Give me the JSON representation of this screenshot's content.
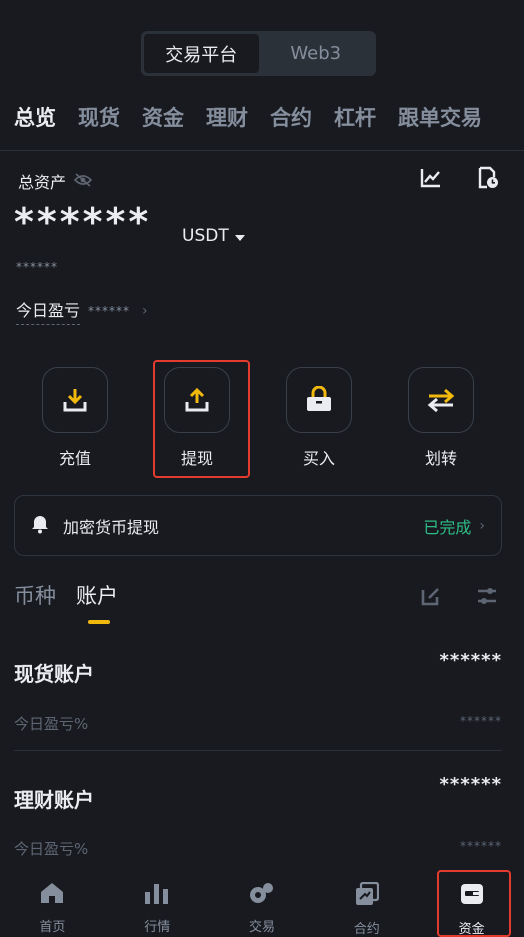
{
  "platform_switch": {
    "items": [
      "交易平台",
      "Web3"
    ],
    "active": 0
  },
  "main_tabs": [
    "总览",
    "现货",
    "资金",
    "理财",
    "合约",
    "杠杆",
    "跟单交易"
  ],
  "overview": {
    "total_label": "总资产",
    "total_value": "******",
    "currency": "USDT",
    "sub_value": "******",
    "today_pnl_label": "今日盈亏",
    "today_pnl_value": "******"
  },
  "actions": [
    {
      "label": "充值",
      "icon": "deposit-icon"
    },
    {
      "label": "提现",
      "icon": "withdraw-icon"
    },
    {
      "label": "买入",
      "icon": "buy-icon"
    },
    {
      "label": "划转",
      "icon": "transfer-icon"
    }
  ],
  "notice": {
    "text": "加密货币提现",
    "status": "已完成"
  },
  "sub_tabs": [
    "币种",
    "账户"
  ],
  "accounts": [
    {
      "name": "现货账户",
      "value": "******",
      "pnl_label": "今日盈亏%",
      "pnl_value": "******"
    },
    {
      "name": "理财账户",
      "value": "******",
      "pnl_label": "今日盈亏%",
      "pnl_value": "******"
    }
  ],
  "bottom_nav": [
    {
      "label": "首页",
      "icon": "home-icon"
    },
    {
      "label": "行情",
      "icon": "markets-icon"
    },
    {
      "label": "交易",
      "icon": "trade-icon"
    },
    {
      "label": "合约",
      "icon": "futures-icon"
    },
    {
      "label": "资金",
      "icon": "wallet-icon"
    }
  ],
  "colors": {
    "accent": "#f0b90b",
    "success": "#2ebd85",
    "highlight": "#e33b2e",
    "bg": "#181a20"
  }
}
